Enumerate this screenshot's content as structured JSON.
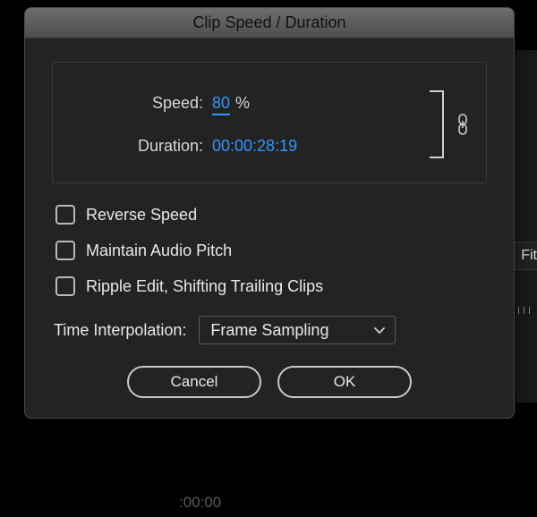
{
  "dialog": {
    "title": "Clip Speed / Duration",
    "speed_label": "Speed:",
    "speed_value": "80",
    "speed_suffix": "%",
    "duration_label": "Duration:",
    "duration_value": "00:00:28:19",
    "linked": true
  },
  "checks": {
    "reverse": {
      "label": "Reverse Speed",
      "checked": false
    },
    "pitch": {
      "label": "Maintain Audio Pitch",
      "checked": false
    },
    "ripple": {
      "label": "Ripple Edit, Shifting Trailing Clips",
      "checked": false
    }
  },
  "interp": {
    "label": "Time Interpolation:",
    "value": "Frame Sampling"
  },
  "buttons": {
    "cancel": "Cancel",
    "ok": "OK"
  },
  "bg": {
    "fit_label": "Fit",
    "timecode": ":00:00"
  }
}
